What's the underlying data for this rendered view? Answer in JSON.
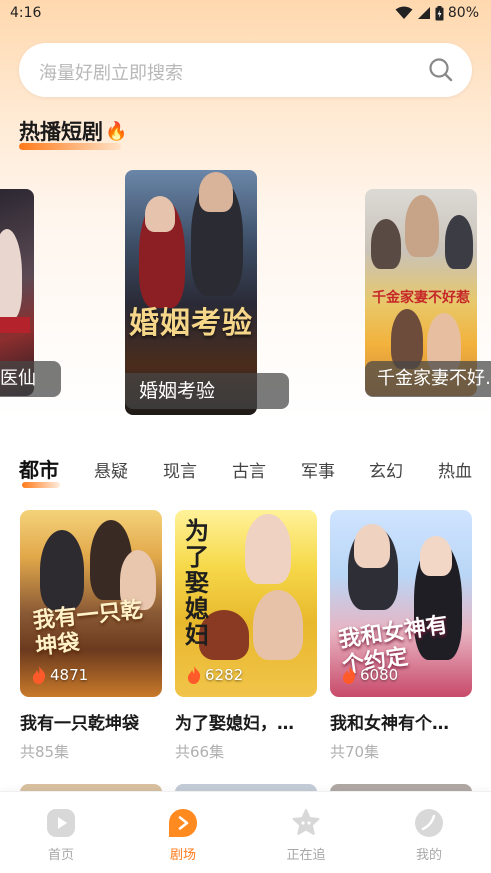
{
  "status_bar": {
    "time": "4:16",
    "battery": "80%"
  },
  "search": {
    "placeholder": "海量好剧立即搜索"
  },
  "hot_section": {
    "title": "热播短剧",
    "emoji": "🔥"
  },
  "carousel": [
    {
      "label": "医仙",
      "poster_text": "医仙"
    },
    {
      "label": "婚姻考验",
      "poster_text": "婚姻考验"
    },
    {
      "label": "千金家妻不好…",
      "poster_text": "千金家妻不好惹"
    }
  ],
  "category_tabs": [
    "都市",
    "悬疑",
    "现言",
    "古言",
    "军事",
    "玄幻",
    "热血"
  ],
  "active_tab": "都市",
  "dramas": [
    {
      "title": "我有一只乾坤袋",
      "heat": "4871",
      "episodes": "共85集",
      "poster_text": "我有一只乾坤袋"
    },
    {
      "title": "为了娶媳妇，…",
      "heat": "6282",
      "episodes": "共66集",
      "poster_text": "为了娶媳妇"
    },
    {
      "title": "我和女神有个…",
      "heat": "6080",
      "episodes": "共70集",
      "poster_text": "我和女神有个约定"
    }
  ],
  "bottom_nav": [
    {
      "label": "首页",
      "icon": "play-circle-icon",
      "active": false
    },
    {
      "label": "剧场",
      "icon": "theater-play-icon",
      "active": true
    },
    {
      "label": "正在追",
      "icon": "star-icon",
      "active": false
    },
    {
      "label": "我的",
      "icon": "profile-leaf-icon",
      "active": false
    }
  ],
  "colors": {
    "accent": "#ff7a1a",
    "inactive": "#a8a8a8"
  }
}
